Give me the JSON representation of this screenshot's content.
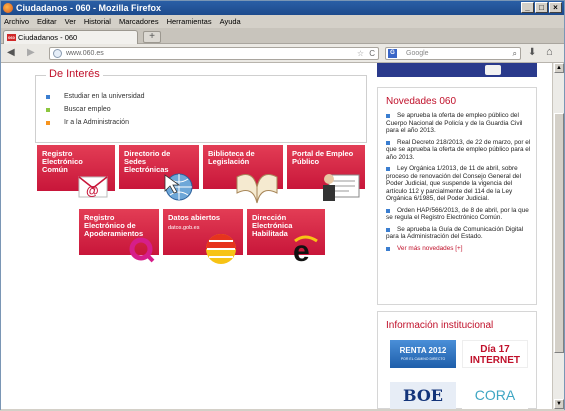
{
  "window": {
    "title": "Ciudadanos - 060 - Mozilla Firefox"
  },
  "menu": [
    "Archivo",
    "Editar",
    "Ver",
    "Historial",
    "Marcadores",
    "Herramientas",
    "Ayuda"
  ],
  "tab": {
    "label": "Ciudadanos - 060",
    "favicon": "060",
    "new_tab": "+"
  },
  "nav": {
    "url": "www.060.es",
    "search_placeholder": "Google",
    "search_engine": "G"
  },
  "interes": {
    "title": "De Interés",
    "items": [
      {
        "label": "Estudiar en la universidad",
        "color": "#3b7ed0"
      },
      {
        "label": "Buscar empleo",
        "color": "#8cc63f"
      },
      {
        "label": "Ir a la Administración",
        "color": "#f7941d"
      }
    ]
  },
  "tiles": [
    {
      "label": "Registro\nElectrónico\nComún",
      "icon": "mail-icon"
    },
    {
      "label": "Directorio de\nSedes\nElectrónicas",
      "icon": "globe-cursor-icon"
    },
    {
      "label": "Biblioteca de\nLegislación",
      "icon": "book-icon"
    },
    {
      "label": "Portal de Empleo\nPúblico",
      "icon": "job-person-icon"
    },
    {
      "label": "Registro\nElectrónico de\nApoderamientos",
      "icon": "q-logo-icon"
    },
    {
      "label": "Datos abiertos",
      "sub": "datos.gob.es",
      "icon": "opendata-logo-icon"
    },
    {
      "label": "Dirección\nElectrónica\nHabilitada",
      "icon": "e-logo-icon"
    }
  ],
  "novedades": {
    "title": "Novedades 060",
    "items": [
      "Se aprueba la oferta de empleo público del Cuerpo Nacional de Policía y de la Guardia Civil para el año 2013.",
      "Real Decreto 218/2013, de 22 de marzo, por el que se aprueba la oferta de empleo público para el año 2013.",
      "Ley Orgánica 1/2013, de 11 de abril, sobre proceso de renovación del Consejo General del Poder Judicial, que suspende la vigencia del artículo 112 y parcialmente del 114 de la Ley Orgánica 6/1985, del Poder Judicial.",
      "Orden HAP/566/2013, de 8 de abril, por la que se regula el Registro Electrónico Común.",
      "Se aprueba la Guía de Comunicación Digital para la Administración del Estado."
    ],
    "more": "Ver más novedades [+]"
  },
  "info": {
    "title": "Información institucional",
    "renta": "RENTA 2012",
    "renta_sub": "POR EL CAMINO DIRECTO",
    "dia_internet": "Día 17 INTERNET",
    "boe": "BOE",
    "cora": "CORA"
  }
}
